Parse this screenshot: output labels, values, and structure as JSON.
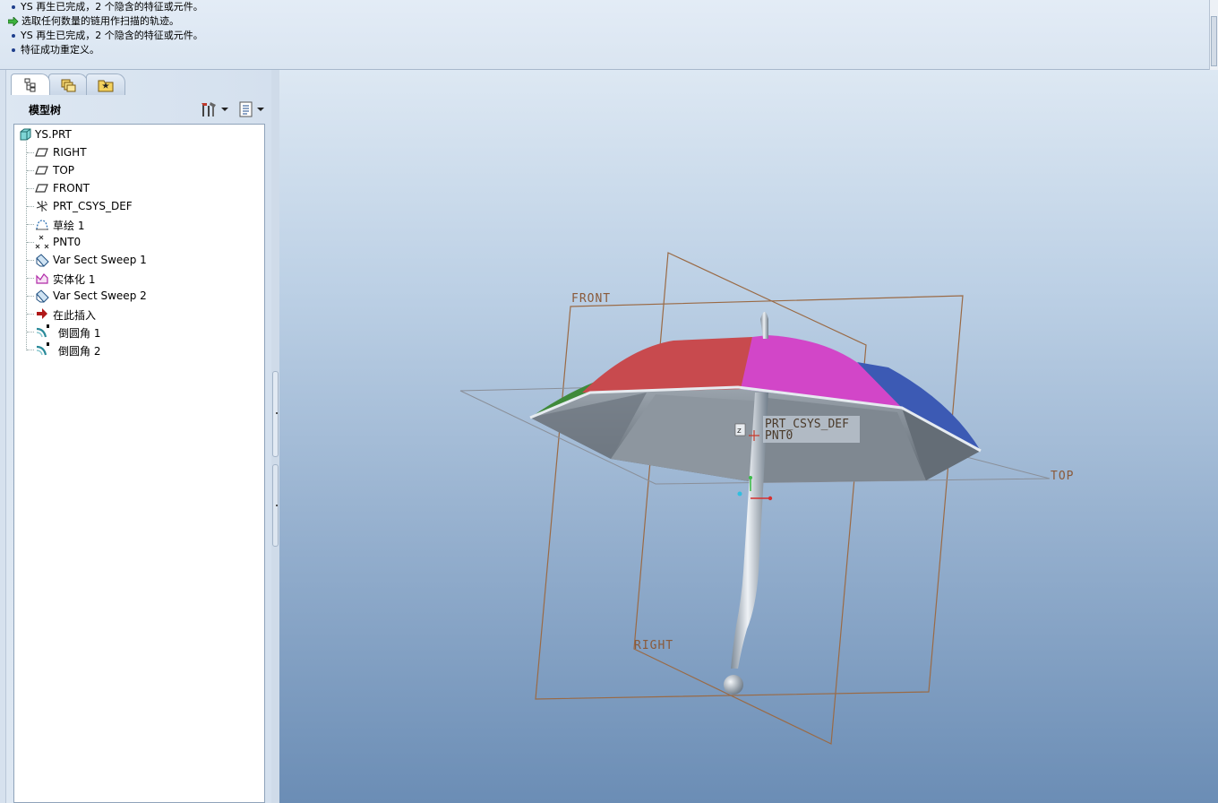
{
  "messages": [
    {
      "type": "info",
      "text": "YS 再生已完成，2 个隐含的特征或元件。"
    },
    {
      "type": "prompt",
      "text": "选取任何数量的链用作扫描的轨迹。"
    },
    {
      "type": "info",
      "text": "YS 再生已完成，2 个隐含的特征或元件。"
    },
    {
      "type": "info",
      "text": "特征成功重定义。"
    }
  ],
  "navigator": {
    "tabs": [
      {
        "icon": "model-tree-icon",
        "active": true
      },
      {
        "icon": "folder-browser-icon",
        "active": false
      },
      {
        "icon": "favorites-icon",
        "active": false
      }
    ],
    "title": "模型树",
    "settings_icon": "tree-settings-icon",
    "show_icon": "tree-show-icon"
  },
  "model_tree": {
    "root": "YS.PRT",
    "items": [
      {
        "label": "RIGHT",
        "icon": "datum-plane-icon"
      },
      {
        "label": "TOP",
        "icon": "datum-plane-icon"
      },
      {
        "label": "FRONT",
        "icon": "datum-plane-icon"
      },
      {
        "label": "PRT_CSYS_DEF",
        "icon": "csys-icon"
      },
      {
        "label": "草绘 1",
        "icon": "sketch-icon"
      },
      {
        "label": "PNT0",
        "icon": "datum-point-icon"
      },
      {
        "label": "Var Sect Sweep 1",
        "icon": "sweep-icon"
      },
      {
        "label": "实体化 1",
        "icon": "solidify-icon"
      },
      {
        "label": "Var Sect Sweep 2",
        "icon": "sweep-icon"
      },
      {
        "label": "在此插入",
        "icon": "insert-here-icon"
      },
      {
        "label": "倒圆角 1",
        "icon": "round-icon"
      },
      {
        "label": "倒圆角 2",
        "icon": "round-icon"
      }
    ]
  },
  "graphics": {
    "plane_labels": {
      "front": "FRONT",
      "top": "TOP",
      "right": "RIGHT"
    },
    "csys_label": "PRT_CSYS_DEF",
    "point_label": "PNT0",
    "colors": {
      "datum_plane": "#9a6a45",
      "canopy_red": "#c84a4e",
      "canopy_magenta": "#d246c8",
      "canopy_blue": "#3c5ab4",
      "canopy_green": "#3f8a3a"
    }
  }
}
